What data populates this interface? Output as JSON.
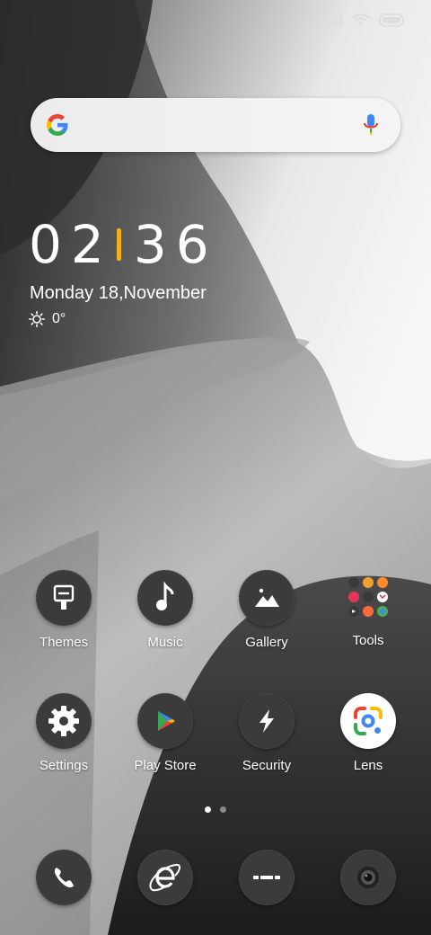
{
  "status_bar": {
    "signal_icon": "signal-icon",
    "wifi_icon": "wifi-icon",
    "battery_icon": "battery-icon"
  },
  "search_bar": {
    "logo_icon": "google-g-icon",
    "mic_icon": "microphone-icon"
  },
  "clock": {
    "hours": "02",
    "minutes": "36",
    "separator_color": "#f2b01e"
  },
  "date": "Monday 18,November",
  "weather": {
    "icon": "sun-icon",
    "temperature": "0°"
  },
  "apps_row1": [
    {
      "label": "Themes",
      "icon": "paintbrush-icon"
    },
    {
      "label": "Music",
      "icon": "music-note-icon"
    },
    {
      "label": "Gallery",
      "icon": "mountain-image-icon"
    },
    {
      "label": "Tools",
      "icon": "folder-grid-icon"
    }
  ],
  "apps_row2": [
    {
      "label": "Settings",
      "icon": "gear-icon"
    },
    {
      "label": "Play Store",
      "icon": "play-store-icon"
    },
    {
      "label": "Security",
      "icon": "lightning-bolt-icon"
    },
    {
      "label": "Lens",
      "icon": "google-lens-icon"
    }
  ],
  "page_indicator": {
    "pages": 2,
    "active": 1
  },
  "dock": [
    {
      "icon": "phone-icon"
    },
    {
      "icon": "browser-icon"
    },
    {
      "icon": "messages-icon"
    },
    {
      "icon": "camera-icon"
    }
  ]
}
